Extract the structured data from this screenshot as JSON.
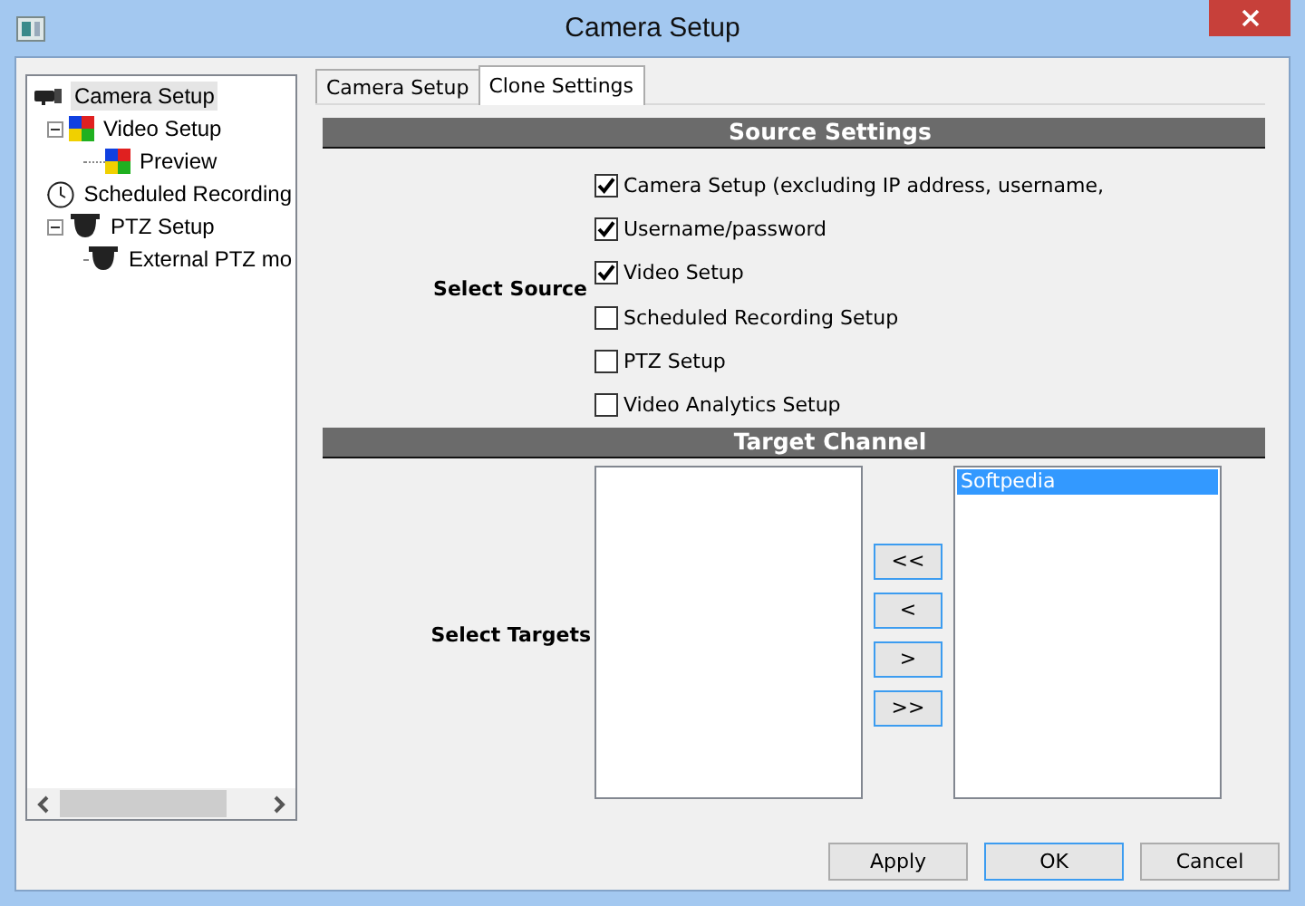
{
  "window": {
    "title": "Camera Setup"
  },
  "tree": [
    {
      "label": "Camera Setup",
      "kind": "camera",
      "selected": true,
      "children": [
        {
          "label": "Video Setup",
          "kind": "grid",
          "selected": false,
          "expanded": true,
          "children": [
            {
              "label": "Preview",
              "kind": "grid",
              "selected": false
            }
          ]
        },
        {
          "label": "Scheduled Recording",
          "kind": "clock",
          "selected": false
        },
        {
          "label": "PTZ Setup",
          "kind": "dome",
          "selected": false,
          "expanded": true,
          "children": [
            {
              "label": "External PTZ mo",
              "kind": "dome",
              "selected": false
            }
          ]
        }
      ]
    }
  ],
  "tabs": [
    {
      "label": "Camera Setup",
      "selected": false
    },
    {
      "label": "Clone Settings",
      "selected": true
    }
  ],
  "source": {
    "header": "Source Settings",
    "label": "Select Source",
    "options": [
      {
        "label": "Camera Setup (excluding IP address, username,",
        "checked": true
      },
      {
        "label": "Username/password",
        "checked": true
      },
      {
        "label": "Video Setup",
        "checked": true
      },
      {
        "label": "Scheduled Recording Setup",
        "checked": false
      },
      {
        "label": "PTZ Setup",
        "checked": false
      },
      {
        "label": "Video Analytics Setup",
        "checked": false
      }
    ]
  },
  "target": {
    "header": "Target Channel",
    "label": "Select Targets",
    "move_buttons": [
      "<<",
      "<",
      ">",
      ">>"
    ],
    "selected_list": [
      {
        "label": "Softpedia",
        "selected": true
      }
    ]
  },
  "buttons": [
    {
      "label": "Apply",
      "default": false
    },
    {
      "label": "OK",
      "default": true
    },
    {
      "label": "Cancel",
      "default": false
    }
  ]
}
